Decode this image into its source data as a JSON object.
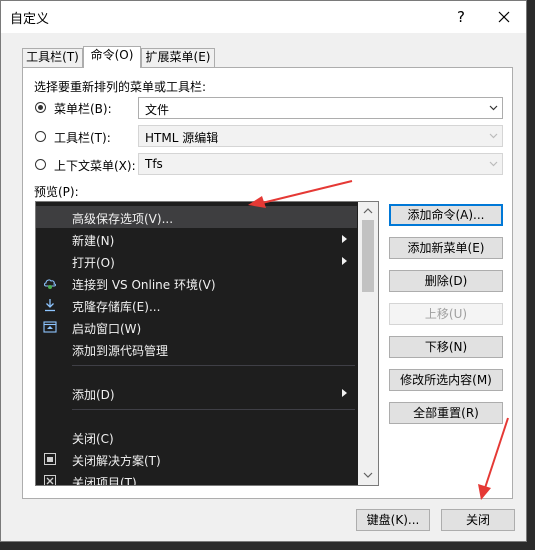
{
  "window": {
    "title": "自定义",
    "help_label": "?"
  },
  "tabs": [
    {
      "label": "工具栏(T)",
      "active": false
    },
    {
      "label": "命令(O)",
      "active": true
    },
    {
      "label": "扩展菜单(E)",
      "active": false
    }
  ],
  "choose_label": "选择要重新排列的菜单或工具栏:",
  "options": [
    {
      "label": "菜单栏(B):",
      "value": "文件",
      "checked": true,
      "enabled": true
    },
    {
      "label": "工具栏(T):",
      "value": "HTML 源编辑",
      "checked": false,
      "enabled": false
    },
    {
      "label": "上下文菜单(X):",
      "value": "Tfs",
      "checked": false,
      "enabled": false
    }
  ],
  "preview_label": "预览(P):",
  "preview_items": [
    {
      "label": "高级保存选项(V)...",
      "icon": "",
      "submenu": false,
      "selected": true
    },
    {
      "label": "新建(N)",
      "icon": "",
      "submenu": true,
      "selected": false
    },
    {
      "label": "打开(O)",
      "icon": "",
      "submenu": true,
      "selected": false
    },
    {
      "label": "连接到 VS Online 环境(V)",
      "icon": "cloud-connect-icon",
      "submenu": false,
      "selected": false
    },
    {
      "label": "克隆存储库(E)...",
      "icon": "download-icon",
      "submenu": false,
      "selected": false
    },
    {
      "label": "启动窗口(W)",
      "icon": "start-window-icon",
      "submenu": false,
      "selected": false
    },
    {
      "label": "添加到源代码管理",
      "icon": "",
      "submenu": false,
      "selected": false
    },
    {
      "separator": true
    },
    {
      "label": "添加(D)",
      "icon": "",
      "submenu": true,
      "selected": false
    },
    {
      "separator": true
    },
    {
      "label": "关闭(C)",
      "icon": "",
      "submenu": false,
      "selected": false
    },
    {
      "label": "关闭解决方案(T)",
      "icon": "close-solution-icon",
      "submenu": false,
      "selected": false
    },
    {
      "label": "关闭项目(T)",
      "icon": "close-project-icon",
      "submenu": false,
      "selected": false
    }
  ],
  "side_buttons": [
    {
      "label": "添加命令(A)...",
      "enabled": true,
      "is_default": true
    },
    {
      "label": "添加新菜单(E)",
      "enabled": true,
      "is_default": false
    },
    {
      "label": "删除(D)",
      "enabled": true,
      "is_default": false
    },
    {
      "label": "上移(U)",
      "enabled": false,
      "is_default": false
    },
    {
      "label": "下移(N)",
      "enabled": true,
      "is_default": false
    },
    {
      "label": "修改所选内容(M)",
      "enabled": true,
      "is_default": false
    },
    {
      "label": "全部重置(R)",
      "enabled": true,
      "is_default": false
    }
  ],
  "footer": {
    "keyboard_label": "键盘(K)...",
    "close_label": "关闭"
  },
  "colors": {
    "annotation_arrow": "#e53935",
    "menu_background": "#1e1e1e",
    "accent": "#0078d7"
  }
}
